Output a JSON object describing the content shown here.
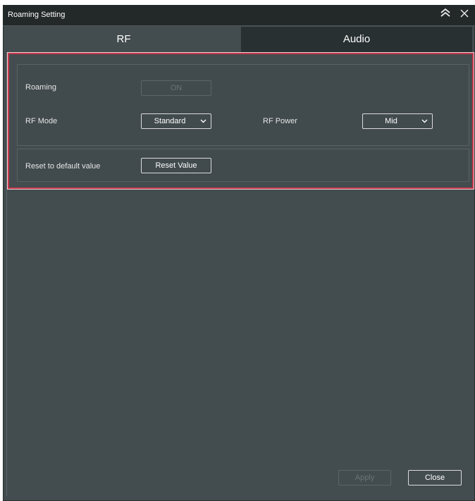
{
  "window": {
    "title": "Roaming Setting",
    "collapse_icon": "double-chevron-up-icon",
    "close_icon": "close-icon"
  },
  "tabs": [
    {
      "label": "RF",
      "selected": true
    },
    {
      "label": "Audio",
      "selected": false
    }
  ],
  "rf": {
    "roaming": {
      "label": "Roaming",
      "value": "ON",
      "enabled": false
    },
    "rf_mode": {
      "label": "RF Mode",
      "value": "Standard"
    },
    "rf_power": {
      "label": "RF Power",
      "value": "Mid"
    },
    "reset": {
      "label": "Reset to default value",
      "button": "Reset Value"
    }
  },
  "footer": {
    "apply_label": "Apply",
    "apply_enabled": false,
    "close_label": "Close"
  },
  "colors": {
    "background": "#434c4f",
    "titlebar": "#232829",
    "inactive_tab": "#283031",
    "highlight": "#c4374a"
  }
}
